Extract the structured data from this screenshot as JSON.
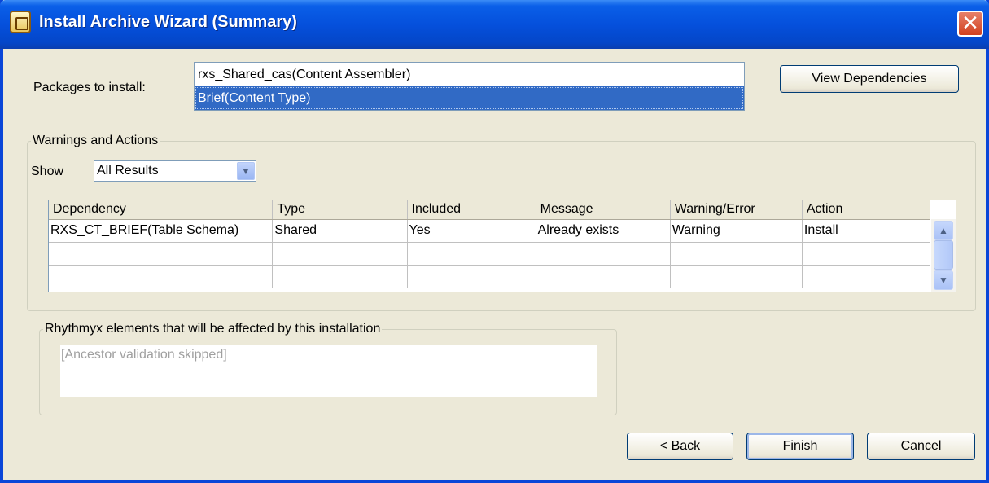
{
  "window": {
    "title": "Install Archive Wizard (Summary)"
  },
  "packages": {
    "label": "Packages to install:",
    "items": [
      "rxs_Shared_cas(Content Assembler)",
      "Brief(Content Type)"
    ]
  },
  "buttons": {
    "view_dependencies": "View Dependencies",
    "back": "< Back",
    "finish": "Finish",
    "cancel": "Cancel"
  },
  "warnings": {
    "legend": "Warnings and Actions",
    "show_label": "Show",
    "show_value": "All Results",
    "columns": [
      "Dependency",
      "Type",
      "Included",
      "Message",
      "Warning/Error",
      "Action"
    ],
    "rows": [
      [
        "RXS_CT_BRIEF(Table Schema)",
        "Shared",
        "Yes",
        "Already exists",
        "Warning",
        "Install"
      ]
    ]
  },
  "affected": {
    "legend": "Rhythmyx elements that will be affected by this installation",
    "text": "[Ancestor validation skipped]"
  },
  "icons": {
    "title": "wizard-app-icon",
    "close": "close-icon",
    "dropdown": "chevron-down-icon",
    "scroll_up": "scroll-up-icon",
    "scroll_down": "scroll-down-icon"
  },
  "colors": {
    "titlebar": "#0550dc",
    "selection": "#316ac5",
    "dialog": "#ece9d8"
  }
}
